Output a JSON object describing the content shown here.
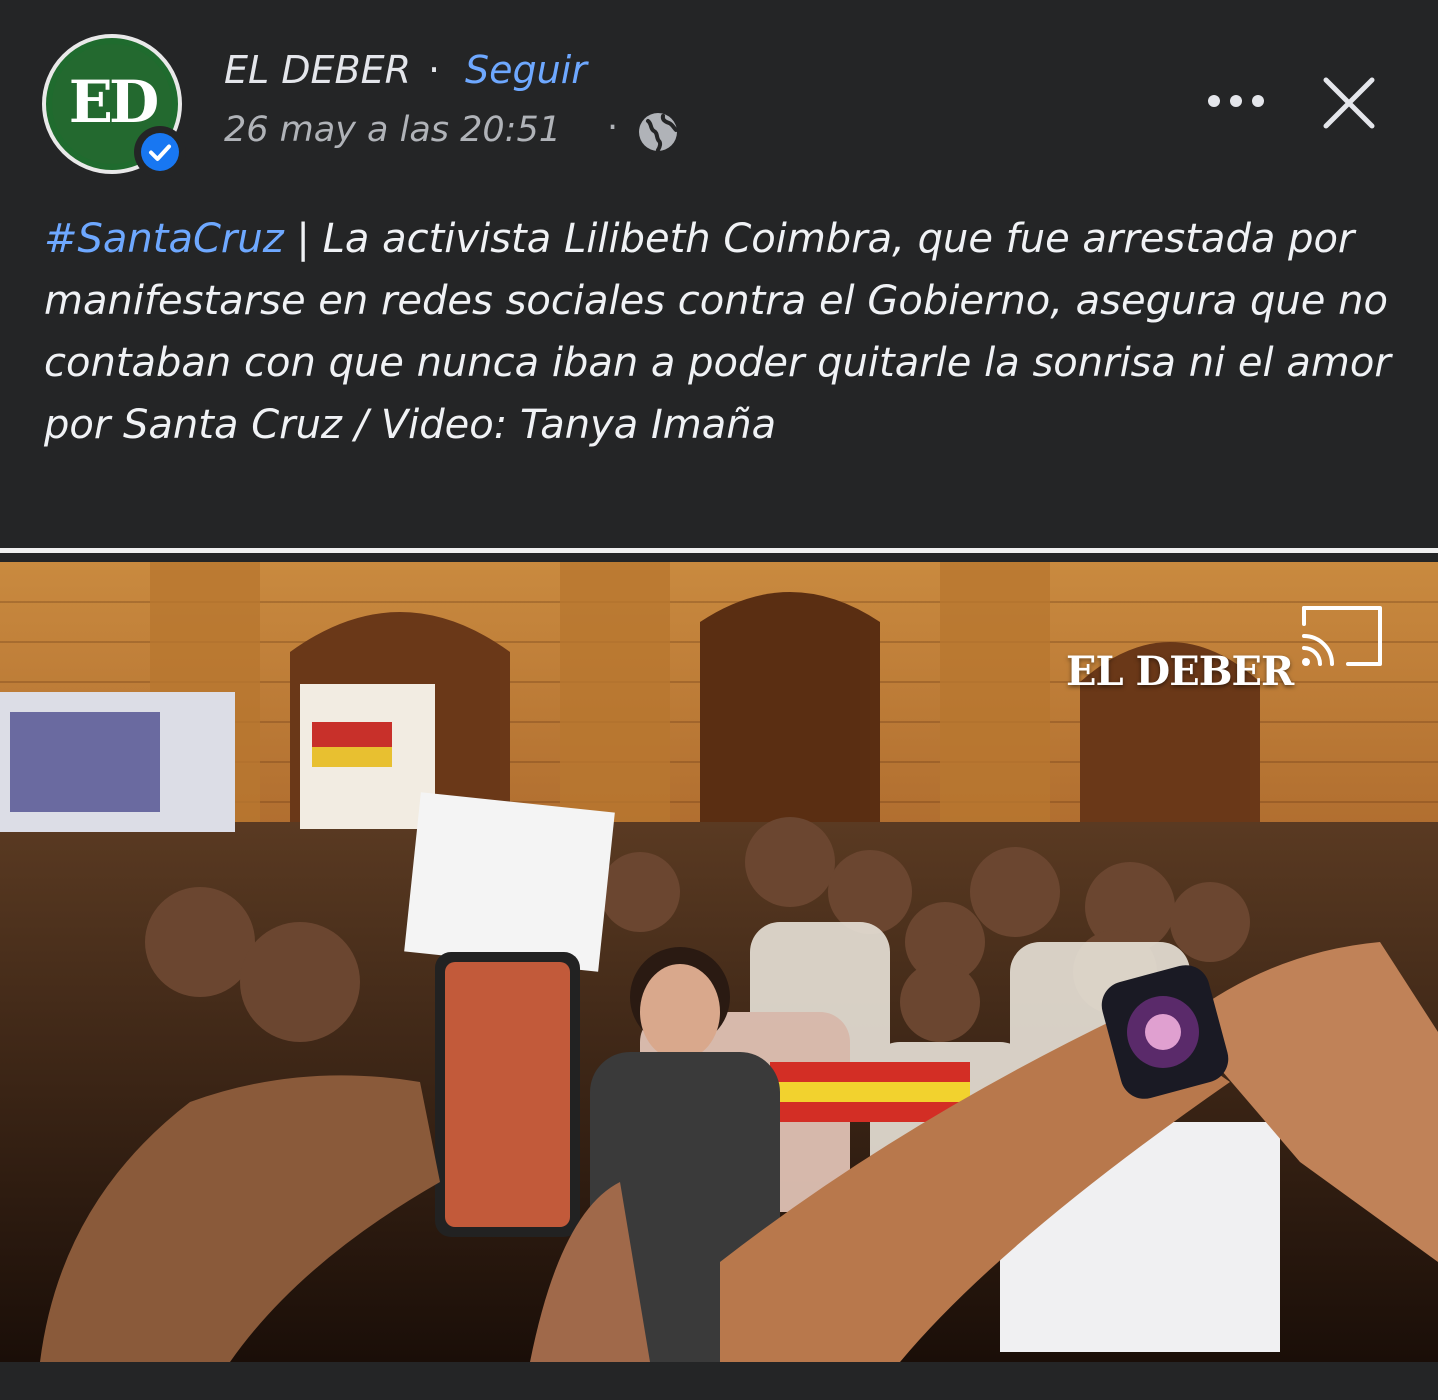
{
  "post": {
    "avatar_text": "ED",
    "page_name": "EL DEBER",
    "separator": "·",
    "follow_label": "Seguir",
    "timestamp": "26 may a las 20:51",
    "caption_hashtag": "#SantaCruz",
    "caption_text": " | La activista Lilibeth Coimbra, que fue arrestada por manifestarse en redes sociales contra el Gobierno, asegura que no contaban con que nunca iban a poder quitarle la sonrisa ni el amor por Santa Cruz / Video: Tanya Imaña"
  },
  "video": {
    "watermark": "EL DEBER"
  },
  "icons": {
    "verified": "verified-badge-icon",
    "audience": "globe-icon",
    "more": "more-options-icon",
    "close": "close-icon",
    "cast": "cast-icon"
  },
  "colors": {
    "background": "#242526",
    "link": "#6ea8ff",
    "avatar_green": "#23692f",
    "verified_blue": "#1877f2"
  }
}
